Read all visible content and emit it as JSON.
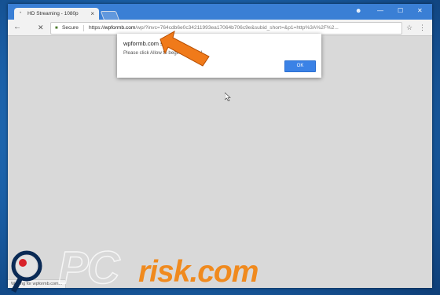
{
  "browser": {
    "tab_title": "HD Streaming - 1080p",
    "tab_close": "×",
    "controls": {
      "account": "☻",
      "minimize": "—",
      "maximize": "☐",
      "close": "✕"
    },
    "back": "←",
    "stop": "✕",
    "secure_label": "Secure",
    "url_scheme": "https://",
    "url_host": "wpformb.com",
    "url_path": "/wp/?invc=764cdb6e0c34211993ea17064b706c9e&subid_short=&p1=http%3A%2F%2...",
    "star": "☆",
    "menu": "⋮",
    "status_text": "Waiting for wpformb.com..."
  },
  "dialog": {
    "title": "wpformb.com says",
    "message": "Please click Allow to begin watching!",
    "ok_label": "OK"
  },
  "watermark": {
    "pc": "PC",
    "risk": "risk.com",
    "accent_color": "#f08a1e"
  },
  "colors": {
    "background": "#1f68b0",
    "titlebar": "#3a7fd5",
    "ok_button": "#3b82e6",
    "arrow": "#f07a1a"
  }
}
